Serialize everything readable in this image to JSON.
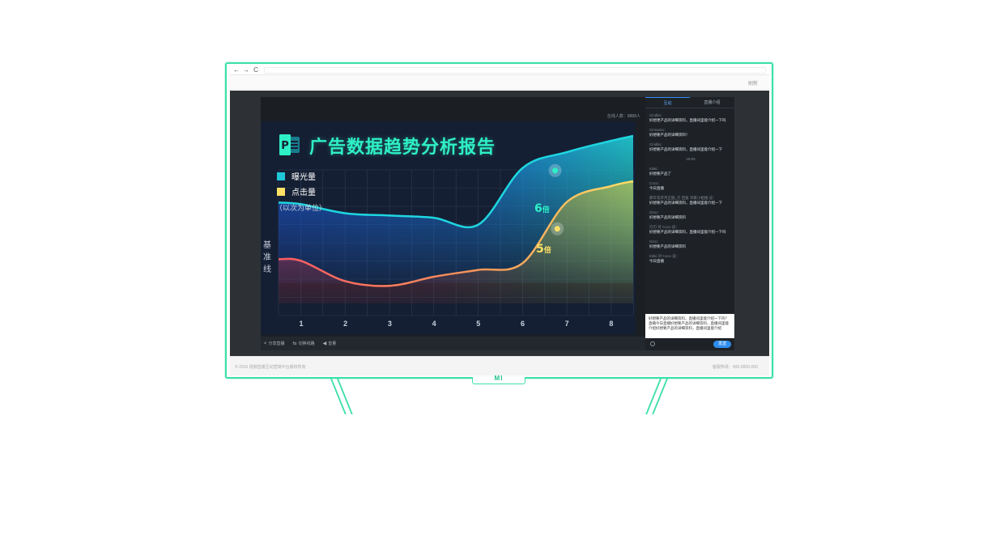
{
  "browser": {
    "back": "←",
    "forward": "→",
    "reload": "C"
  },
  "site_header": {
    "link": "刷新"
  },
  "player": {
    "viewer_count": "在线人数：8888人",
    "controls": [
      {
        "icon": "share-icon",
        "label": "分享直播"
      },
      {
        "icon": "switch-icon",
        "label": "切换线路"
      },
      {
        "icon": "volume-icon",
        "label": "音量"
      }
    ]
  },
  "slide": {
    "title": "广告数据趋势分析报告",
    "ppt_letter": "P",
    "legend": [
      {
        "label": "曝光量",
        "color": "#1ec8d8"
      },
      {
        "label": "点击量",
        "color": "#ffe066"
      }
    ],
    "unit_note": "（以次为单位）",
    "y_label": "基准线",
    "annotations": {
      "a6_num": "6",
      "a6_unit": "倍",
      "a5_num": "5",
      "a5_unit": "倍"
    }
  },
  "chart_data": {
    "type": "area",
    "title": "广告数据趋势分析报告",
    "categories": [
      "1",
      "2",
      "3",
      "4",
      "5",
      "6",
      "7",
      "8"
    ],
    "series": [
      {
        "name": "曝光量",
        "color": "#1ec8d8",
        "values": [
          0.72,
          0.68,
          0.67,
          0.66,
          0.63,
          0.88,
          0.95,
          1.0
        ]
      },
      {
        "name": "点击量",
        "color": "#ffe066",
        "values": [
          0.47,
          0.38,
          0.36,
          0.4,
          0.43,
          0.46,
          0.73,
          0.8
        ]
      }
    ],
    "annotations": [
      "6倍",
      "5倍"
    ],
    "ylabel": "基准线",
    "ylim": [
      0,
      1
    ],
    "grid": true
  },
  "chat": {
    "tabs": [
      "互动",
      "直播介绍"
    ],
    "messages": [
      {
        "who": "Cindila：",
        "text": "好想更产品的详细资料，直播间里能介绍一下吗"
      },
      {
        "who": "Cinnamo：",
        "text": "好想要产品的详细资料！"
      },
      {
        "who": "Cindila：",
        "text": "好想要产品的详细资料，直播间里能介绍一下"
      },
      {
        "who": "18:00",
        "text": "",
        "time": true
      },
      {
        "who": "Kikki：",
        "text": "好想要产品了"
      },
      {
        "who": "Coco：",
        "text": "今日直播"
      },
      {
        "who": "那年花开月正圆_刃 回复 邻家小姐姐 说：",
        "text": "好想要产品的详细资料，直播间里能介绍一下"
      },
      {
        "who": "Gino：",
        "text": "好想要产品的详细资料"
      },
      {
        "who": "刃刃 对 Coco 说：",
        "text": "好想要产品的详细资料，直播间里能介绍一下吗"
      },
      {
        "who": "Gino：",
        "text": "好想要产品的详细资料"
      },
      {
        "who": "Kikki 对 Coco 说：",
        "text": "今日直播"
      }
    ],
    "input_text": "好想要产品的详细资料，直播间里能介绍一下吗？直播今日直播好想要产品的详细资料，直播间里能介绍好想要产品的详细资料，直播间里能介绍",
    "send_label": "发送"
  },
  "footer": {
    "copyright": "© 2016 视频直播互动营销平台版权所有",
    "hotline": "客服热线：400-0000-000"
  },
  "tv": {
    "brand": "MI"
  }
}
